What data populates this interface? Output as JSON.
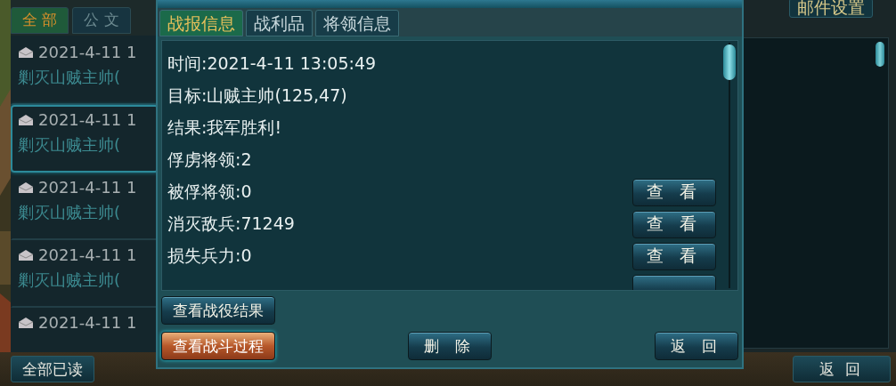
{
  "mail_list": {
    "tabs": [
      {
        "label": "全 部",
        "selected": true
      },
      {
        "label": "公 文",
        "selected": false
      }
    ],
    "items": [
      {
        "date": "2021-4-11 1",
        "subject": "剿灭山贼主帅(",
        "selected": false
      },
      {
        "date": "2021-4-11 1",
        "subject": "剿灭山贼主帅(",
        "selected": true
      },
      {
        "date": "2021-4-11 1",
        "subject": "剿灭山贼主帅(",
        "selected": false
      },
      {
        "date": "2021-4-11 1",
        "subject": "剿灭山贼主帅(",
        "selected": false
      },
      {
        "date": "2021-4-11 1",
        "selected": false
      }
    ]
  },
  "settings_button": "邮件设置",
  "footer": {
    "mark_all_read": "全部已读",
    "back": "返 回"
  },
  "report": {
    "tabs": [
      {
        "label": "战报信息",
        "selected": true
      },
      {
        "label": "战利品",
        "selected": false
      },
      {
        "label": "将领信息",
        "selected": false
      }
    ],
    "lines": [
      {
        "text": "时间:2021-4-11 13:05:49"
      },
      {
        "text": "目标:山贼主帅(125,47)"
      },
      {
        "text": "结果:我军胜利!"
      },
      {
        "text": "俘虏将领:2"
      },
      {
        "text": "被俘将领:0",
        "action": "查 看"
      },
      {
        "text": "消灭敌兵:71249",
        "action": "查 看"
      },
      {
        "text": "损失兵力:0",
        "action": "查 看"
      }
    ],
    "buttons": {
      "left": [
        {
          "label": "查看战役结果",
          "highlighted": false
        },
        {
          "label": "查看战斗过程",
          "highlighted": true
        }
      ],
      "middle": [
        {
          "label": "删 除",
          "highlighted": false
        }
      ],
      "right": [
        {
          "label": "返 回",
          "highlighted": false
        }
      ]
    }
  }
}
